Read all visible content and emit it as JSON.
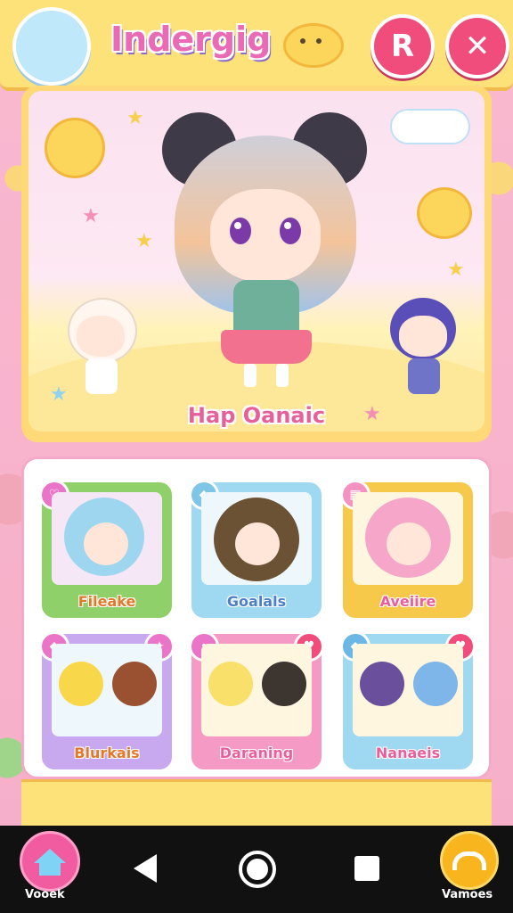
{
  "header": {
    "title": "Indergig",
    "right_button_label": "R",
    "close_label": "✕"
  },
  "hero": {
    "caption": "Hap Oanaic"
  },
  "cards": [
    {
      "label": "Fileake",
      "border": "#8fd06a",
      "label_color": "#e2792a",
      "badge": "♡",
      "badge_color": "#e974c8"
    },
    {
      "label": "Goalals",
      "border": "#9fd8f1",
      "label_color": "#4b7fc7",
      "badge": "◆",
      "badge_color": "#7fc5e6"
    },
    {
      "label": "Aveiire",
      "border": "#f7c94a",
      "label_color": "#e85f9d",
      "badge": "▦",
      "badge_color": "#f492c1"
    },
    {
      "label": "Blurkais",
      "border": "#c8a9ef",
      "label_color": "#e2792a",
      "badge": "◆",
      "badge_color": "#e974c8"
    },
    {
      "label": "Daraning",
      "border": "#f49ac4",
      "label_color": "#e85f9d",
      "badge": "•",
      "badge_color": "#e974c8"
    },
    {
      "label": "Nanaeis",
      "border": "#9fd8f1",
      "label_color": "#e85f9d",
      "badge": "◆",
      "badge_color": "#6bb8e6"
    }
  ],
  "nav": {
    "left_label": "Vooek",
    "right_label": "Vamoes"
  },
  "colors": {
    "header_bg": "#fde27a",
    "accent_pink": "#f04d7c",
    "title_pink": "#e96ab5"
  }
}
